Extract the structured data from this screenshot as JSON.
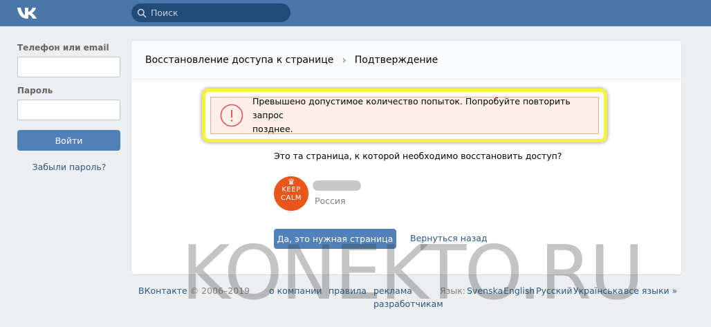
{
  "header": {
    "search_placeholder": "Поиск"
  },
  "sidebar": {
    "phone_label": "Телефон или email",
    "password_label": "Пароль",
    "login_button": "Войти",
    "forgot_link": "Забыли пароль?"
  },
  "card": {
    "breadcrumb_main": "Восстановление доступа к странице",
    "breadcrumb_sep": "›",
    "breadcrumb_current": "Подтверждение",
    "error_line1": "Превышено допустимое количество попыток. Попробуйте повторить запрос",
    "error_line2": "позднее.",
    "question": "Это та страница, к которой необходимо восстановить доступ?",
    "avatar_line1": "KEEP",
    "avatar_line2": "CALM",
    "country": "Россия",
    "confirm_button": "Да, это нужная страница",
    "back_link": "Вернуться назад"
  },
  "footer": {
    "brand": "ВКонтакте",
    "copyright": " © 2006–2019",
    "links": [
      "о компании",
      "правила",
      "реклама",
      "разработчикам"
    ],
    "lang_label": "Язык:",
    "languages": [
      "Svenska",
      "English",
      "Русский",
      "Українська",
      "все языки »"
    ]
  },
  "watermark": "KONEKTO.RU",
  "colors": {
    "topbar": "#4a76a8",
    "button": "#5181b8",
    "link": "#2a5885",
    "highlight": "#f6f33d",
    "error_bg": "#ffefe9"
  }
}
